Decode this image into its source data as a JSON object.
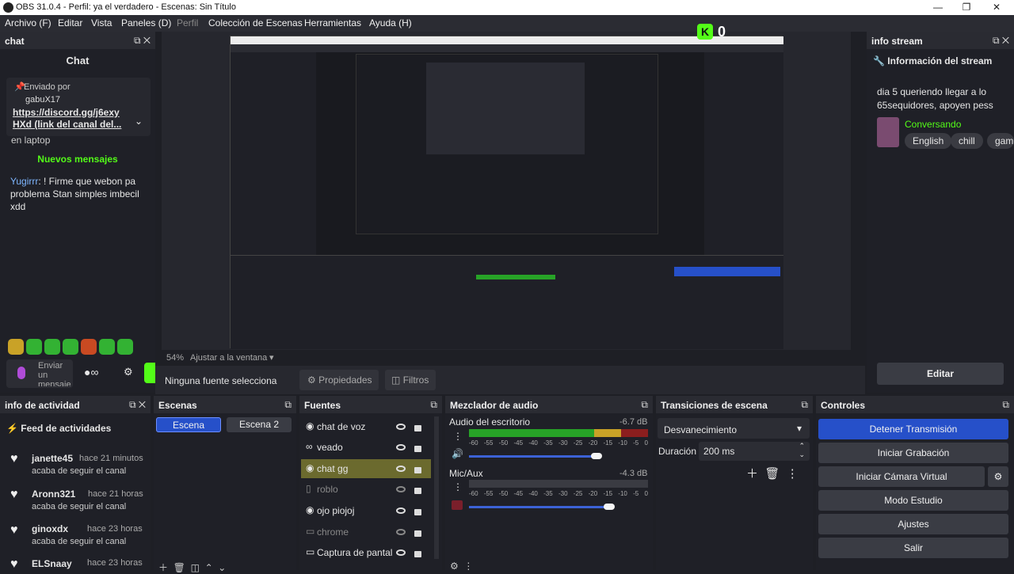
{
  "window": {
    "title": "OBS 31.0.4 - Perfil: ya el verdadero - Escenas: Sin Título"
  },
  "menu": [
    "Archivo (F)",
    "Editar",
    "Vista",
    "Paneles (D)",
    "Perfil",
    "Colección de Escenas",
    "Herramientas",
    "Ayuda (H)"
  ],
  "chat": {
    "dock_title": "chat",
    "header": "Chat",
    "pinned_label": "Enviado por",
    "pinned_user": "gabuX17",
    "pinned_link": "https://discord.gg/j6exy HXd (link del canal del...",
    "partial": "en laptop",
    "new_messages": "Nuevos mensajes",
    "msg_user": "Yugirrr",
    "msg_text": ": ! Firme que webon pa problema Stan simples imbecil xdd",
    "input_placeholder": "Enviar un mensaje"
  },
  "kick": {
    "logo": "K",
    "count": "0"
  },
  "info_stream": {
    "dock_title": "info stream",
    "header": "Información del stream",
    "title": "dia 5 queriendo llegar a lo 65sequidores, apoyen pess",
    "category": "Conversando",
    "tags": [
      "English",
      "chill",
      "gami"
    ],
    "edit": "Editar"
  },
  "preview": {
    "zoom": "54%",
    "fit": "Ajustar a la ventana"
  },
  "source_bar": {
    "none": "Ninguna fuente selecciona",
    "props": "Propiedades",
    "filters": "Filtros"
  },
  "activity": {
    "dock_title": "info de actividad",
    "feed": "Feed de actividades",
    "items": [
      {
        "user": "janette45",
        "time": "hace 21 minutos",
        "action": "acaba de seguir el canal"
      },
      {
        "user": "Aronn321",
        "time": "hace 21 horas",
        "action": "acaba de seguir el canal"
      },
      {
        "user": "ginoxdx",
        "time": "hace 23 horas",
        "action": "acaba de seguir el canal"
      },
      {
        "user": "ELSnaay",
        "time": "hace 23 horas",
        "action": ""
      }
    ]
  },
  "scenes": {
    "dock_title": "Escenas",
    "items": [
      "Escena",
      "Escena 2"
    ]
  },
  "sources": {
    "dock_title": "Fuentes",
    "items": [
      "chat de voz",
      "veado",
      "chat gg",
      "roblo",
      "ojo piojoj",
      "chrome",
      "Captura de pantall:"
    ]
  },
  "mixer": {
    "dock_title": "Mezclador de audio",
    "ch1": "Audio del escritorio",
    "ch1_db": "-6.7 dB",
    "ch2": "Mic/Aux",
    "ch2_db": "-4.3 dB",
    "ticks": [
      "-60",
      "-55",
      "-50",
      "-45",
      "-40",
      "-35",
      "-30",
      "-25",
      "-20",
      "-15",
      "-10",
      "-5",
      "0"
    ]
  },
  "transitions": {
    "dock_title": "Transiciones de escena",
    "type": "Desvanecimiento",
    "duration_label": "Duración",
    "duration": "200 ms"
  },
  "controls": {
    "dock_title": "Controles",
    "buttons": [
      "Detener Transmisión",
      "Iniciar Grabación",
      "Iniciar Cámara Virtual",
      "Modo Estudio",
      "Ajustes",
      "Salir"
    ]
  }
}
